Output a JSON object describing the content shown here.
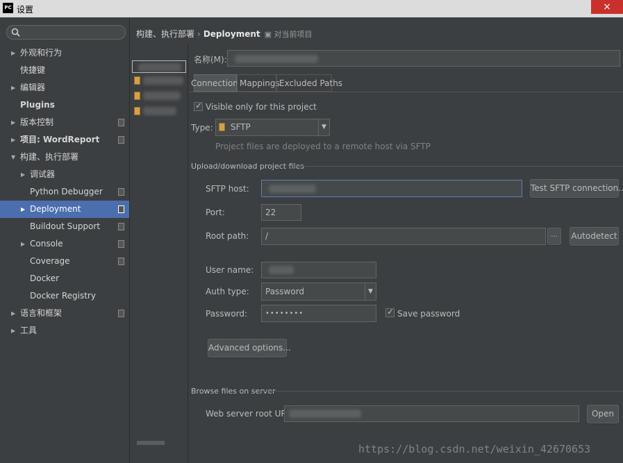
{
  "window": {
    "title": "设置",
    "logo": "PC",
    "close_glyph": "×"
  },
  "search": {
    "placeholder": ""
  },
  "sidebar": {
    "items": [
      {
        "label": "外观和行为",
        "level": 0,
        "arrow": "▶",
        "bold": false,
        "page_icon": false
      },
      {
        "label": "快捷键",
        "level": 0,
        "arrow": "",
        "bold": false,
        "page_icon": false
      },
      {
        "label": "编辑器",
        "level": 0,
        "arrow": "▶",
        "bold": false,
        "page_icon": false
      },
      {
        "label": "Plugins",
        "level": 0,
        "arrow": "",
        "bold": true,
        "page_icon": false
      },
      {
        "label": "版本控制",
        "level": 0,
        "arrow": "▶",
        "bold": false,
        "page_icon": true
      },
      {
        "label": "项目: WordReport",
        "level": 0,
        "arrow": "▶",
        "bold": true,
        "page_icon": true
      },
      {
        "label": "构建、执行部署",
        "level": 0,
        "arrow": "▼",
        "bold": false,
        "page_icon": false
      },
      {
        "label": "调试器",
        "level": 1,
        "arrow": "▶",
        "bold": false,
        "page_icon": false
      },
      {
        "label": "Python Debugger",
        "level": 1,
        "arrow": "",
        "bold": false,
        "page_icon": true
      },
      {
        "label": "Deployment",
        "level": 1,
        "arrow": "▶",
        "bold": false,
        "page_icon": true,
        "selected": true
      },
      {
        "label": "Buildout Support",
        "level": 1,
        "arrow": "",
        "bold": false,
        "page_icon": true
      },
      {
        "label": "Console",
        "level": 1,
        "arrow": "▶",
        "bold": false,
        "page_icon": true
      },
      {
        "label": "Coverage",
        "level": 1,
        "arrow": "",
        "bold": false,
        "page_icon": true
      },
      {
        "label": "Docker",
        "level": 1,
        "arrow": "",
        "bold": false,
        "page_icon": false
      },
      {
        "label": "Docker Registry",
        "level": 1,
        "arrow": "",
        "bold": false,
        "page_icon": false
      },
      {
        "label": "语言和框架",
        "level": 0,
        "arrow": "▶",
        "bold": false,
        "page_icon": true
      },
      {
        "label": "工具",
        "level": 0,
        "arrow": "▶",
        "bold": false,
        "page_icon": false
      }
    ]
  },
  "breadcrumb": {
    "parent": "构建、执行部署",
    "separator": "›",
    "current": "Deployment",
    "project_scope": "对当前项目"
  },
  "toolbar": {
    "add": "+",
    "remove": "−",
    "copy": "⧉",
    "default": "▤"
  },
  "name_field": {
    "label": "名称(M):",
    "value": ""
  },
  "tabs": [
    {
      "label": "Connection",
      "active": true
    },
    {
      "label": "Mappings",
      "active": false
    },
    {
      "label": "Excluded Paths",
      "active": false
    }
  ],
  "connection": {
    "visible_only_label": "Visible only for this project",
    "type_label": "Type:",
    "type_value": "SFTP",
    "type_hint": "Project files are deployed to a remote host via SFTP",
    "upload_section": "Upload/download project files",
    "sftp_host_label": "SFTP host:",
    "test_button": "Test SFTP connection...",
    "port_label": "Port:",
    "port_value": "22",
    "root_path_label": "Root path:",
    "root_path_value": "/",
    "browse_glyph": "...",
    "autodetect_button": "Autodetect",
    "user_name_label": "User name:",
    "auth_type_label": "Auth type:",
    "auth_type_value": "Password",
    "password_label": "Password:",
    "password_value": "••••••••",
    "save_password_label": "Save password",
    "advanced_button": "Advanced options...",
    "browse_section": "Browse files on server",
    "web_url_label": "Web server root URL:",
    "open_button": "Open"
  },
  "watermark": "https://blog.csdn.net/weixin_42670653"
}
